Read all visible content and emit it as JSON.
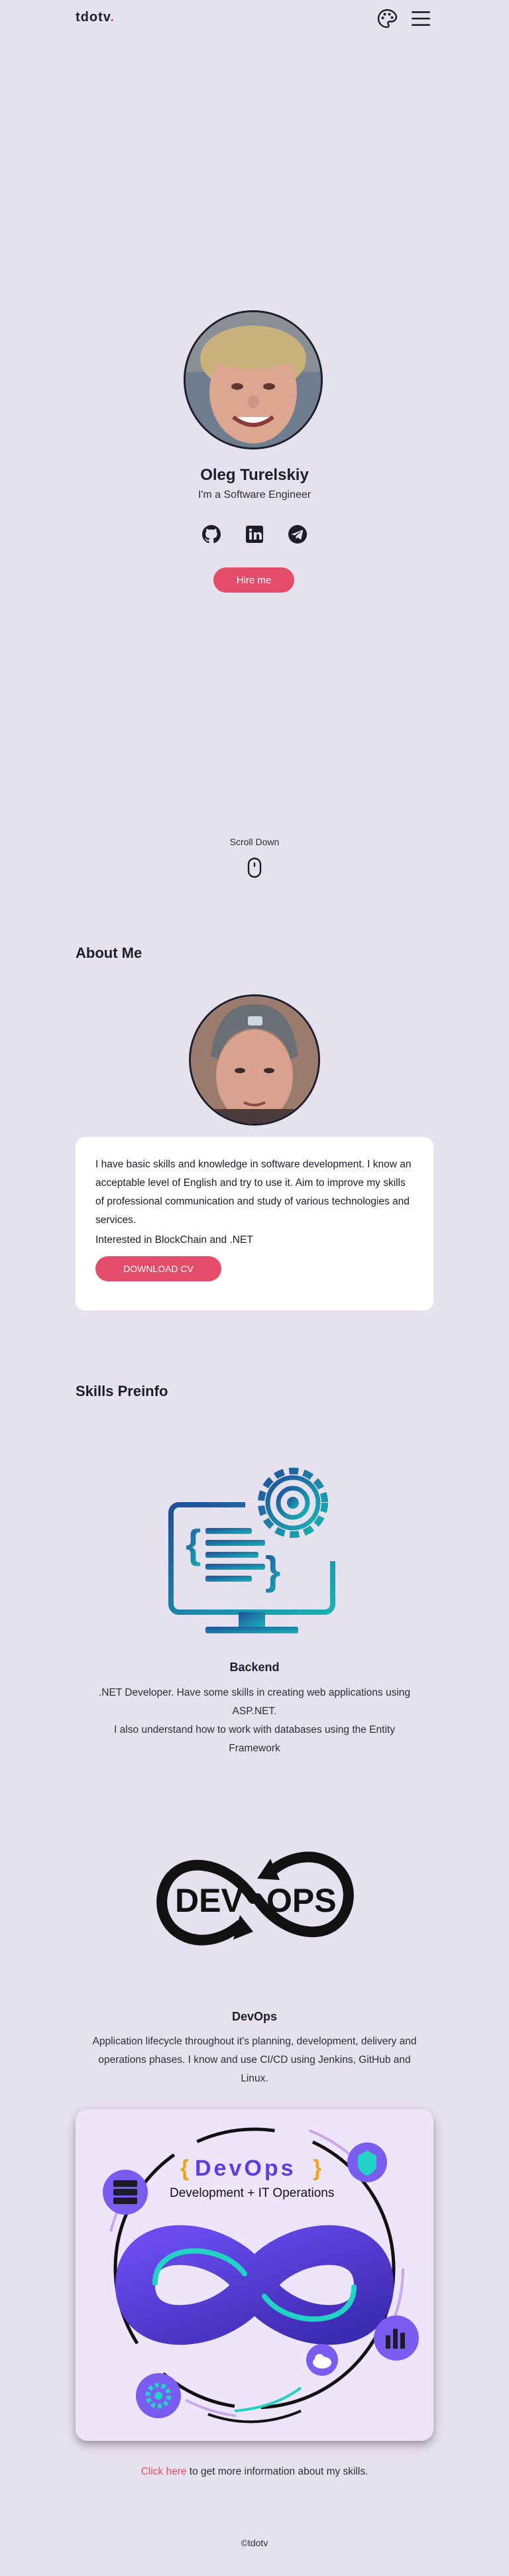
{
  "header": {
    "logo_text": "tdotv",
    "logo_dot": ".",
    "palette_icon": "palette-icon",
    "menu_icon": "hamburger-menu-icon"
  },
  "hero": {
    "name": "Oleg Turelskiy",
    "subtitle": "I'm a Software Engineer",
    "socials": [
      "github-icon",
      "linkedin-icon",
      "telegram-icon"
    ],
    "hire_label": "Hire me",
    "scroll_label": "Scroll Down"
  },
  "about": {
    "title": "About Me",
    "text": "I have basic skills and knowledge in software development. I know an acceptable level of English and try to use it. Aim to improve my skills of professional communication and study of various technologies and services.",
    "interest": "Interested in BlockChain and .NET",
    "cv_label": "DOWNLOAD CV"
  },
  "skills": {
    "title": "Skills Preinfo",
    "items": [
      {
        "title": "Backend",
        "lines": [
          ".NET Developer. Have some skills in creating web applications using ASP.NET.",
          "I also understand how to work with databases using the Entity Framework"
        ]
      },
      {
        "title": "DevOps",
        "lines": [
          "Application lifecycle throughout it's planning, development, delivery and operations phases. I know and use CI/CD using Jenkins, GitHub and Linux."
        ]
      }
    ],
    "devops_logo_left": "DEV",
    "devops_logo_right": "OPS",
    "devops_card": {
      "brace_left": "{",
      "title": "DevOps",
      "brace_right": "}",
      "subtitle": "Development + IT Operations"
    },
    "more_link": "Click here",
    "more_text": " to get more information about my skills."
  },
  "footer": {
    "text": "©tdotv"
  },
  "colors": {
    "background": "#e6e1ef",
    "accent": "#e34d6a",
    "text": "#1c1c2b",
    "teal": "#1a9aa8",
    "purple": "#5a3ee0"
  }
}
